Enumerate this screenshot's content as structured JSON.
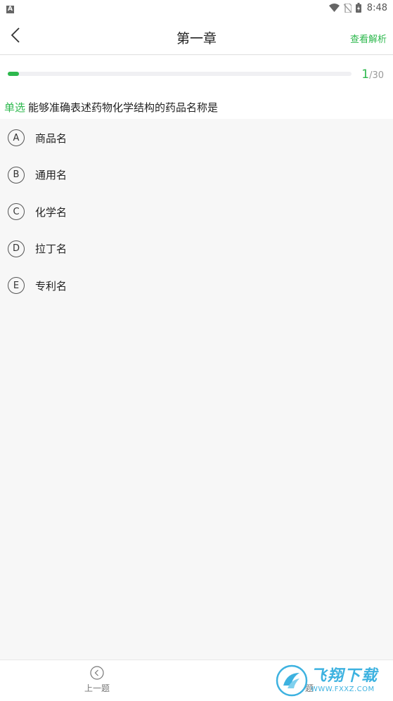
{
  "status_bar": {
    "notification_letter": "A",
    "time": "8:48"
  },
  "header": {
    "title": "第一章",
    "action_label": "查看解析"
  },
  "progress": {
    "current": "1",
    "total_label": "/30",
    "fraction": 0.033
  },
  "question": {
    "type_label": "单选",
    "text": "能够准确表述药物化学结构的药品名称是"
  },
  "options": [
    {
      "letter": "A",
      "text": "商品名"
    },
    {
      "letter": "B",
      "text": "通用名"
    },
    {
      "letter": "C",
      "text": "化学名"
    },
    {
      "letter": "D",
      "text": "拉丁名"
    },
    {
      "letter": "E",
      "text": "专利名"
    }
  ],
  "footer": {
    "prev_label": "上一题",
    "next_label": "下一题"
  },
  "watermark": {
    "brand_cn": "飞翔下载",
    "url": "WWW.FXXZ.COM"
  },
  "colors": {
    "accent": "#2db84d",
    "watermark": "#3db2e0"
  }
}
